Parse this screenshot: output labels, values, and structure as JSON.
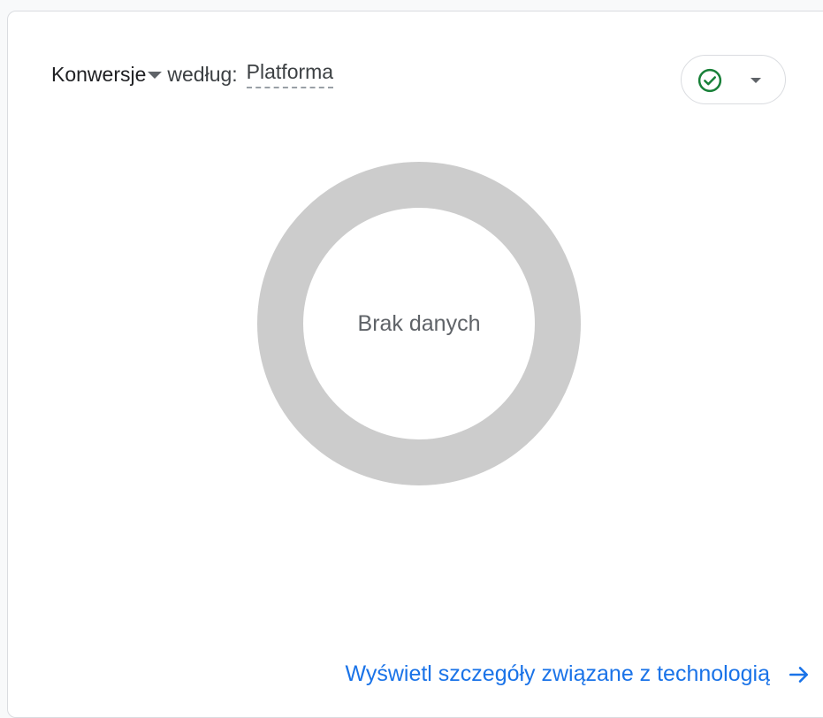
{
  "card": {
    "metric_label": "Konwersje",
    "by_label": "według:",
    "dimension_label": "Platforma",
    "status_icon": "check-circle-icon",
    "status_color": "#188038",
    "dropdown_icon": "caret-down-icon"
  },
  "chart_data": {
    "type": "pie",
    "values": [],
    "empty_message": "Brak danych",
    "ring_color": "#cccccc"
  },
  "footer": {
    "link_label": "Wyświetl szczegóły związane z technologią",
    "link_icon": "arrow-right-icon",
    "link_color": "#1a73e8"
  }
}
